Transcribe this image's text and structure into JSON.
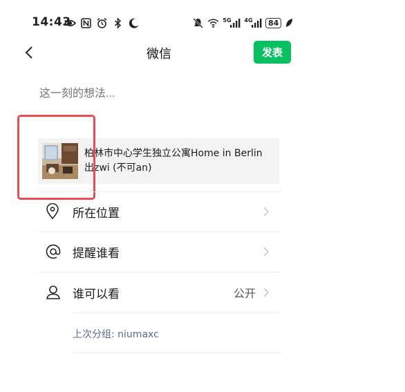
{
  "status_bar": {
    "time": "14:43",
    "left_icons": [
      "eye-icon",
      "nfc-icon",
      "alarm-icon",
      "bluetooth-icon",
      "moon-icon"
    ],
    "right_icons": [
      "mute-icon",
      "wifi-icon",
      "signal-5g-icon",
      "signal-4g-icon",
      "battery-icon",
      "leaf-icon"
    ],
    "signal1_label": "5G",
    "signal2_label": "4G",
    "battery": "84"
  },
  "nav": {
    "title": "微信",
    "publish": "发表"
  },
  "composer": {
    "placeholder": "这一刻的想法..."
  },
  "link_card": {
    "title_line1": "柏林市中心学生独立公寓Home in Berlin",
    "title_line2": "出zwi (不可an)"
  },
  "rows": {
    "location": {
      "label": "所在位置"
    },
    "mention": {
      "label": "提醒谁看"
    },
    "visibility": {
      "label": "谁可以看",
      "value": "公开"
    }
  },
  "last_group": "上次分组: niumaxc",
  "colors": {
    "accent": "#07c160",
    "link": "#576b95",
    "highlight": "#e84c56"
  }
}
